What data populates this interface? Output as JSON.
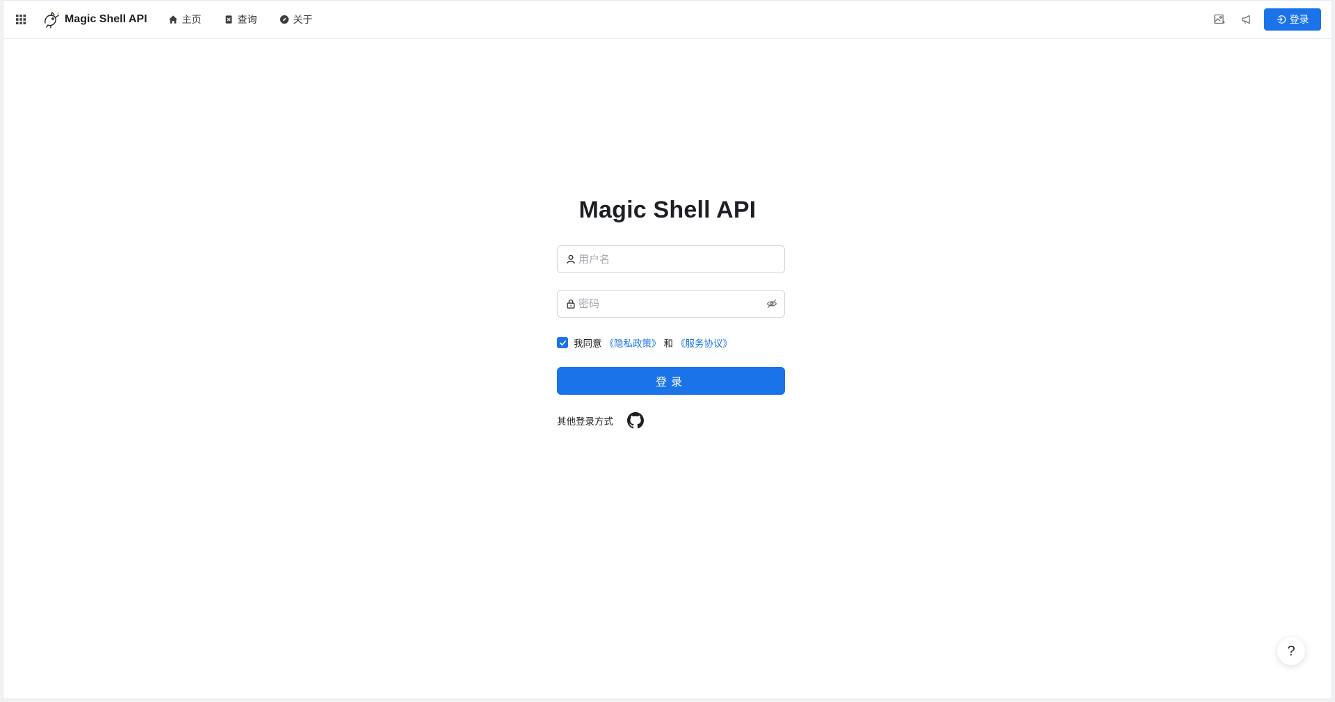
{
  "header": {
    "brand_name": "Magic Shell API",
    "nav": [
      {
        "label": "主页",
        "icon": "home-icon"
      },
      {
        "label": "查询",
        "icon": "query-icon"
      },
      {
        "label": "关于",
        "icon": "compass-icon"
      }
    ],
    "actions": [
      {
        "icon": "image-settings-icon"
      },
      {
        "icon": "announcement-icon"
      }
    ],
    "login_label": "登录"
  },
  "form": {
    "title": "Magic Shell API",
    "username_placeholder": "用户名",
    "password_placeholder": "密码",
    "agree_prefix": "我同意",
    "privacy_link": "《隐私政策》",
    "and_text": "和",
    "terms_link": "《服务协议》",
    "agree_checked": true,
    "submit_label": "登录",
    "other_login_label": "其他登录方式",
    "other_login_icon": "github-icon"
  },
  "help": {
    "label": "?"
  },
  "colors": {
    "accent": "#1a73e8",
    "text": "#1c1f23",
    "placeholder": "#a6aab1",
    "border": "#d3d6db"
  }
}
